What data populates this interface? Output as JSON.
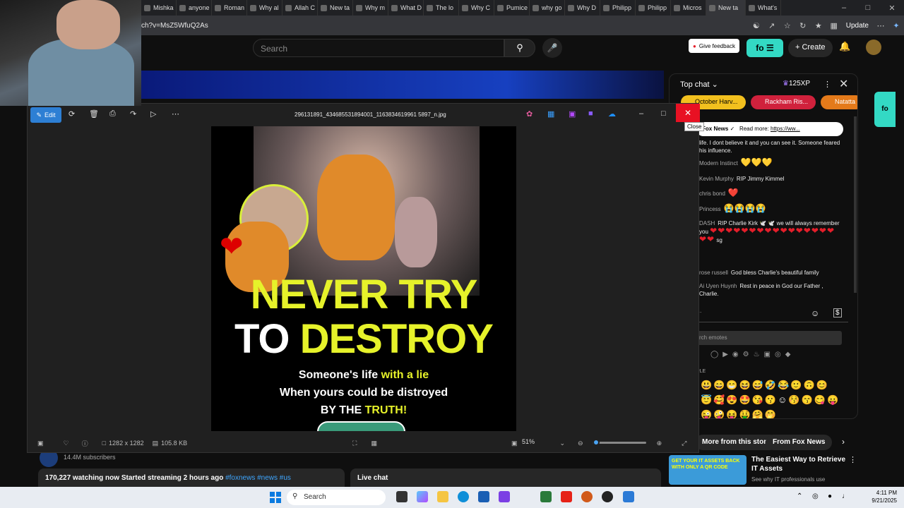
{
  "browser": {
    "tabs": [
      "Mishka",
      "anyone",
      "Roman",
      "Why al",
      "Allah C",
      "New ta",
      "Why m",
      "What D",
      "The lo",
      "Why C",
      "Pumice",
      "why go",
      "Why D",
      "Philipp",
      "Philipp",
      "Micros",
      "New ta",
      "What's"
    ],
    "url": "ch?v=MsZ5WfuQ2As",
    "update_label": "Update"
  },
  "youtube": {
    "search_placeholder": "Search",
    "give_feedback": "Give feedback",
    "create_label": "Create",
    "subscribers": "14.4M subscribers",
    "watching": "170,227 watching now",
    "started": "Started streaming 2 hours ago",
    "hashtags": "#foxnews #news #us",
    "live_chat_label": "Live chat",
    "more_from_story": "More from this story",
    "from_fox": "From Fox News",
    "ad_title": "The Easiest Way to Retrieve IT Assets",
    "ad_sub": "See why IT professionals use",
    "ad_thumb_text": "GET YOUR IT ASSETS BACK WITH ONLY A QR CODE"
  },
  "photos": {
    "edit_label": "Edit",
    "filename": "296131891_434685531894001_1163834619961 5897_n.jpg",
    "close_tooltip": "Close",
    "dimensions": "1282 x 1282",
    "filesize": "105.8 KB",
    "zoom": "51%",
    "zoom_fraction": 0.07,
    "image_text": {
      "line1": "NEVER TRY",
      "line2a": "TO ",
      "line2b": "DESTROY",
      "sub1a": "Someone's life ",
      "sub1b": "with a lie",
      "sub2": "When yours could be distroyed",
      "sub3a": "BY THE ",
      "sub3b": "TRUTH!"
    }
  },
  "chat": {
    "title": "Top chat",
    "xp": "125XP",
    "chips": [
      "October Harv...",
      "Rackham Ris...",
      "Natatta"
    ],
    "pinned_source": "Fox News",
    "pinned_text": "Read more:",
    "pinned_link": "https://ww...",
    "messages": [
      {
        "author": "",
        "text": "life. I dont believe it and you can see it. Someone feared his influence."
      },
      {
        "author": "Modern Instinct",
        "text": "💛💛💛"
      },
      {
        "author": "Kevin Murphy",
        "text": "RIP Jimmy Kimmel"
      },
      {
        "author": "chris bond",
        "text": "❤️"
      },
      {
        "author": "Princess",
        "text": "😭😭😭😭"
      },
      {
        "author": "DASH",
        "text": "RIP Charlie Kirk 🕊️ 🕊️ we will always remember you"
      },
      {
        "author": "rose russell",
        "text": "God bless Charlie's beautiful family"
      },
      {
        "author": "Ai Uyen Huynh",
        "text": "Rest in peace in God our Father , Charlie."
      }
    ],
    "hearts_row": "❤❤❤❤❤❤❤❤❤❤❤❤❤❤❤❤❤❤",
    "hearts_suffix": "sg",
    "input_placeholder": "...",
    "emote_search_placeholder": "rch emotes",
    "emote_section": "PLE",
    "emotes": "😃😄😁😆😅🤣😂🙂🙃😊😇🥰😍🤩😘😗☺😚😙😋😛😜🤪😝🤑🤗🤭"
  },
  "taskbar": {
    "search_label": "Search",
    "time": "4:11 PM",
    "date": "9/21/2025"
  }
}
